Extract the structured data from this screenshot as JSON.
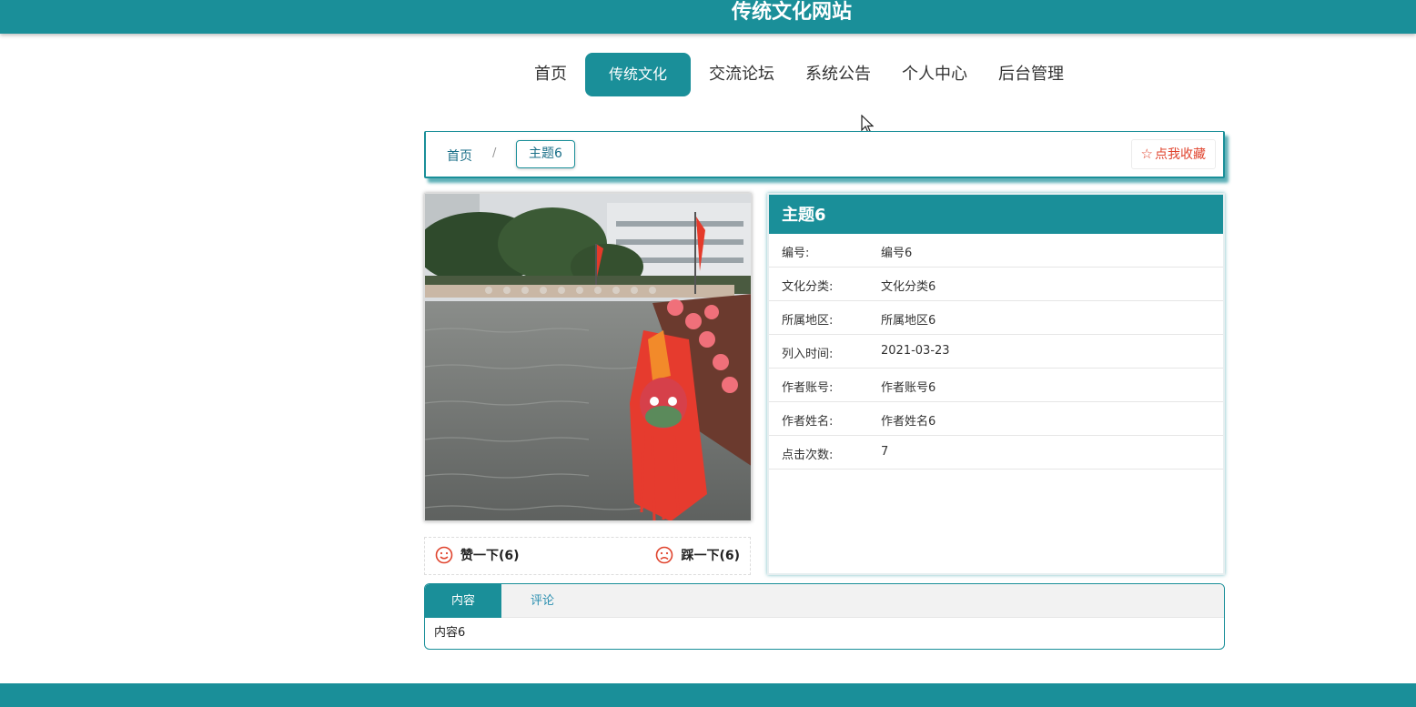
{
  "site": {
    "title": "传统文化网站"
  },
  "nav": {
    "items": [
      {
        "label": "首页"
      },
      {
        "label": "传统文化"
      },
      {
        "label": "交流论坛"
      },
      {
        "label": "系统公告"
      },
      {
        "label": "个人中心"
      },
      {
        "label": "后台管理"
      }
    ],
    "active_index": 1
  },
  "breadcrumb": {
    "home": "首页",
    "separator": "/",
    "current": "主题6",
    "favorite_star": "☆",
    "favorite_label": "点我收藏"
  },
  "votes": {
    "like_label": "赞一下(6)",
    "dislike_label": "踩一下(6)"
  },
  "detail": {
    "title": "主题6",
    "rows": [
      {
        "key": "编号:",
        "value": "编号6"
      },
      {
        "key": "文化分类:",
        "value": "文化分类6"
      },
      {
        "key": "所属地区:",
        "value": "所属地区6"
      },
      {
        "key": "列入时间:",
        "value": "2021-03-23"
      },
      {
        "key": "作者账号:",
        "value": "作者账号6"
      },
      {
        "key": "作者姓名:",
        "value": "作者姓名6"
      },
      {
        "key": "点击次数:",
        "value": "7"
      }
    ]
  },
  "tabs": {
    "items": [
      {
        "label": "内容"
      },
      {
        "label": "评论"
      }
    ],
    "active_index": 0,
    "content": "内容6"
  },
  "colors": {
    "primary": "#1a8f99",
    "favorite": "#e0442e",
    "vote_icon": "#e0442e"
  },
  "icons": {
    "favorite": "star-outline-icon",
    "like": "smile-face-icon",
    "dislike": "sad-face-icon"
  }
}
